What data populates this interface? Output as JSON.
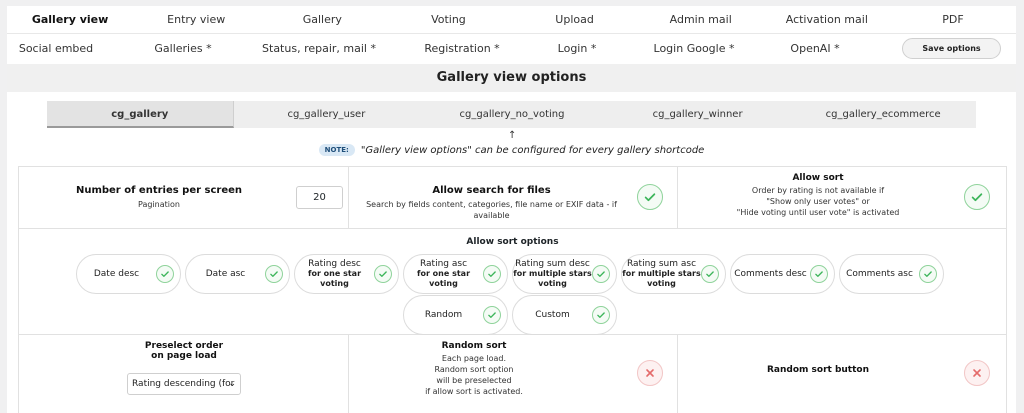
{
  "nav_top": [
    "Gallery view",
    "Entry view",
    "Gallery",
    "Voting",
    "Upload",
    "Admin mail",
    "Activation mail",
    "PDF"
  ],
  "nav_second": [
    "Social embed",
    "Galleries *",
    "Status, repair, mail *",
    "Registration *",
    "Login *",
    "Login Google *",
    "OpenAI *"
  ],
  "save_label": "Save options",
  "section_title": "Gallery view options",
  "tabs": [
    "cg_gallery",
    "cg_gallery_user",
    "cg_gallery_no_voting",
    "cg_gallery_winner",
    "cg_gallery_ecommerce"
  ],
  "arrow": "↑",
  "note": {
    "badge": "NOTE:",
    "text": "\"Gallery view options\" can be configured for every gallery shortcode"
  },
  "entries": {
    "title": "Number of entries per screen",
    "sub": "Pagination",
    "value": "20"
  },
  "search": {
    "title": "Allow search for files",
    "sub": "Search by fields content, categories, file name or EXIF data - if available",
    "enabled": true
  },
  "sort": {
    "title": "Allow sort",
    "sub1": "Order by rating is not available if",
    "sub2": "\"Show only user votes\" or",
    "sub3": "\"Hide voting until user vote\" is activated",
    "enabled": true
  },
  "sort_options": {
    "title": "Allow sort options",
    "items": [
      {
        "label": "Date desc",
        "sub": "",
        "checked": true
      },
      {
        "label": "Date asc",
        "sub": "",
        "checked": true
      },
      {
        "label": "Rating desc",
        "sub": "for one star voting",
        "checked": true
      },
      {
        "label": "Rating asc",
        "sub": "for one star voting",
        "checked": true
      },
      {
        "label": "Rating sum desc",
        "sub": "for multiple stars voting",
        "checked": true
      },
      {
        "label": "Rating sum asc",
        "sub": "for multiple stars voting",
        "checked": true
      },
      {
        "label": "Comments desc",
        "sub": "",
        "checked": true
      },
      {
        "label": "Comments asc",
        "sub": "",
        "checked": true
      },
      {
        "label": "Random",
        "sub": "",
        "checked": true
      },
      {
        "label": "Custom",
        "sub": "",
        "checked": true
      }
    ]
  },
  "preselect": {
    "title1": "Preselect order",
    "title2": "on page load",
    "value": "Rating descending (for"
  },
  "random_sort": {
    "title": "Random sort",
    "l1": "Each page load.",
    "l2": "Random sort option",
    "l3": "will be preselected",
    "l4": "if allow sort is activated.",
    "enabled": false
  },
  "random_sort_button": {
    "title": "Random sort button",
    "enabled": false
  },
  "colors": {
    "check_green": "#3cb55a",
    "x_red": "#e46a6a",
    "note_bg": "#d9e8f5"
  }
}
